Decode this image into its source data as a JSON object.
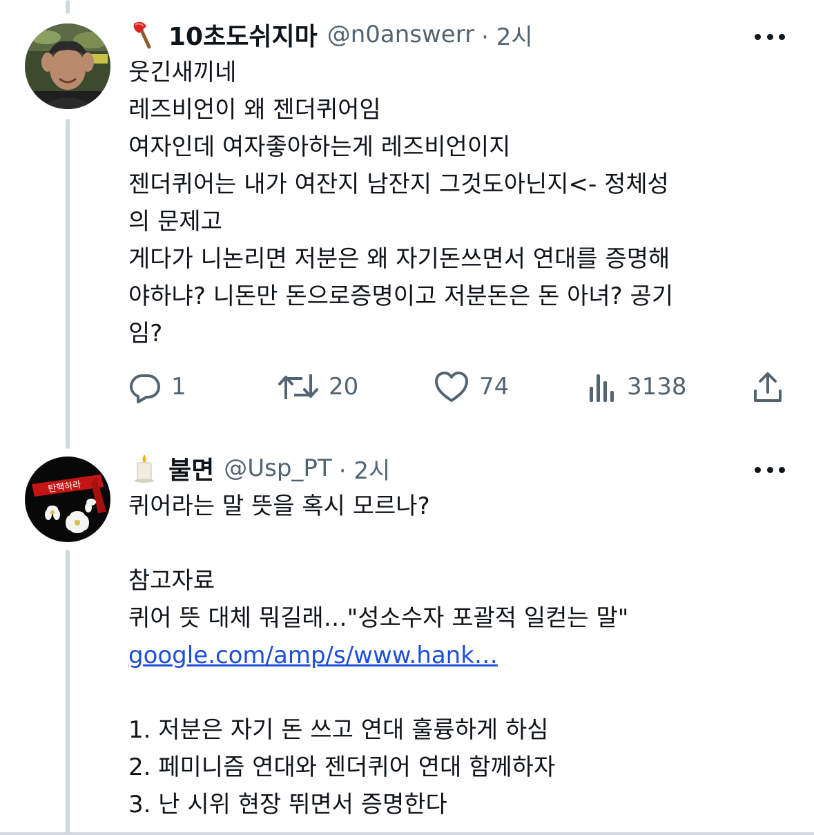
{
  "tweets": [
    {
      "display_name": "10초도쉬지마",
      "handle": "@n0answerr",
      "time": "· 2시",
      "emoji": "axe-icon",
      "lines": [
        "웃긴새끼네",
        "레즈비언이 왜 젠더퀴어임",
        "여자인데 여자좋아하는게 레즈비언이지",
        "젠더퀴어는 내가 여잔지 남잔지 그것도아닌지<- 정체성",
        "의 문제고",
        "게다가 니논리면 저분은 왜 자기돈쓰면서 연대를 증명해",
        "야하냐? 니돈만 돈으로증명이고 저분돈은 돈 아녀? 공기",
        "임?"
      ],
      "actions": {
        "reply_count": "1",
        "retweet_count": "20",
        "like_count": "74",
        "view_count": "3138"
      }
    },
    {
      "display_name": "불면",
      "handle": "@Usp_PT",
      "time": "· 2시",
      "emoji": "candle-icon",
      "avatar_banner_text": "탄핵하라",
      "lines": [
        "퀴어라는 말 뜻을 혹시 모르나?",
        "",
        "참고자료",
        "퀴어 뜻 대체 뭐길래…\"성소수자 포괄적 일컫는 말\"",
        "google.com/amp/s/www.hank…",
        "",
        "1. 저분은 자기 돈 쓰고 연대 훌륭하게 하심",
        "2. 페미니즘 연대와 젠더퀴어 연대 함께하자",
        "3. 난 시위 현장 뛰면서 증명한다"
      ],
      "link_line_index": 4
    }
  ],
  "colors": {
    "text": "#0f1419",
    "secondary": "#536471",
    "link": "#1d4ed8",
    "thread_line": "#cfd9de"
  }
}
